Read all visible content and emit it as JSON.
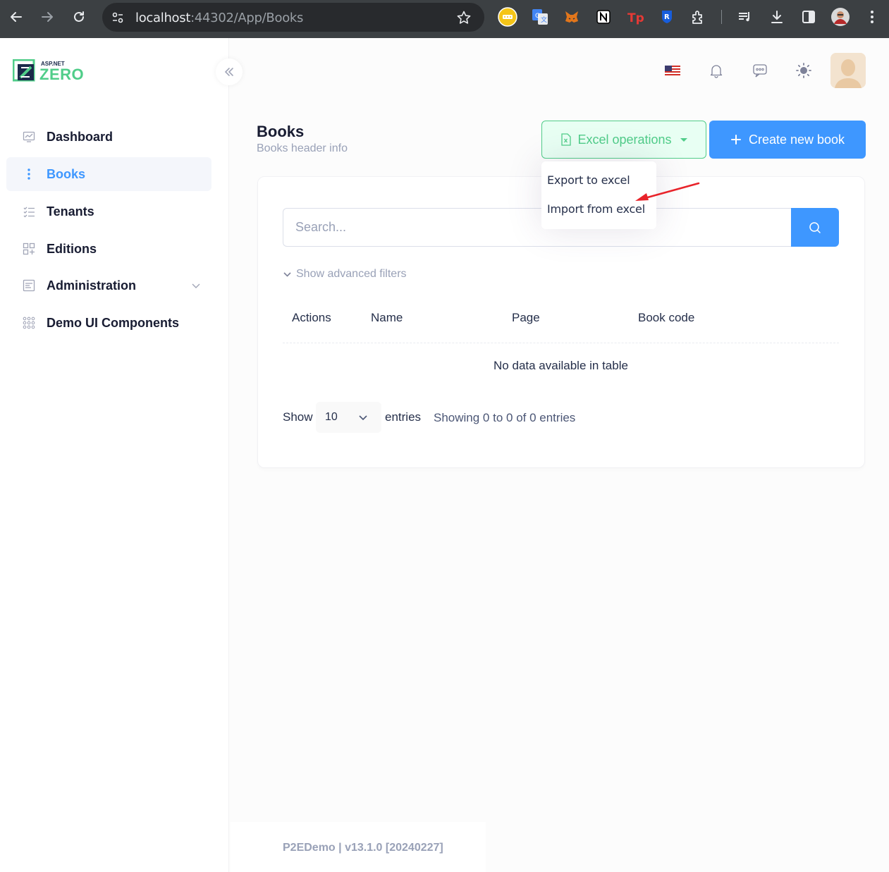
{
  "browser": {
    "url_host": "localhost",
    "url_rest": ":44302/App/Books",
    "extensions": [
      "password-manager-icon",
      "google-translate-icon",
      "metamask-icon",
      "notion-icon",
      "tp-icon",
      "bitwarden-icon",
      "extensions-icon"
    ]
  },
  "sidebar": {
    "logo_top": "ASP.NET",
    "logo_main": "ZERO",
    "items": [
      {
        "label": "Dashboard",
        "icon": "chart-icon"
      },
      {
        "label": "Books",
        "icon": "dots-icon"
      },
      {
        "label": "Tenants",
        "icon": "list-check-icon"
      },
      {
        "label": "Editions",
        "icon": "grid-icon"
      },
      {
        "label": "Administration",
        "icon": "settings-list-icon"
      },
      {
        "label": "Demo UI Components",
        "icon": "apps-icon"
      }
    ]
  },
  "header": {
    "language": "en-US",
    "icons": [
      "flag-icon",
      "bell-icon",
      "chat-icon",
      "sun-icon"
    ]
  },
  "page": {
    "title": "Books",
    "description": "Books header info",
    "excel_button": "Excel operations",
    "create_button": "Create new book",
    "dropdown": {
      "export": "Export to excel",
      "import": "Import from excel"
    },
    "search_placeholder": "Search...",
    "advanced_filters": "Show advanced filters",
    "columns": [
      "Actions",
      "Name",
      "Page",
      "Book code"
    ],
    "empty_message": "No data available in table",
    "show_label": "Show",
    "page_size": "10",
    "entries_label": "entries",
    "info": "Showing 0 to 0 of 0 entries"
  },
  "footer": {
    "text": "P2EDemo | v13.1.0 [20240227]"
  },
  "colors": {
    "primary": "#3e97ff",
    "success": "#50cd89",
    "annotation": "#e8232a"
  }
}
